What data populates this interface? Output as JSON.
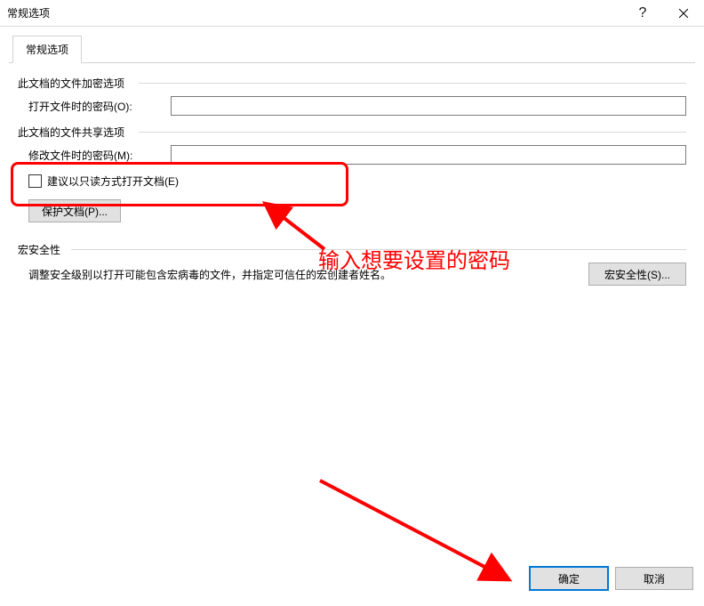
{
  "window": {
    "title": "常规选项"
  },
  "tab": {
    "label": "常规选项"
  },
  "encrypt_group": {
    "title": "此文档的文件加密选项",
    "open_password_label": "打开文件时的密码(O):",
    "open_password_value": ""
  },
  "share_group": {
    "title": "此文档的文件共享选项",
    "modify_password_label": "修改文件时的密码(M):",
    "modify_password_value": "",
    "readonly_label": "建议以只读方式打开文档(E)",
    "protect_button": "保护文档(P)..."
  },
  "macro_group": {
    "title": "宏安全性",
    "description": "调整安全级别以打开可能包含宏病毒的文件，并指定可信任的宏创建者姓名。",
    "macro_button": "宏安全性(S)..."
  },
  "footer": {
    "ok": "确定",
    "cancel": "取消"
  },
  "annotation": {
    "text": "输入想要设置的密码"
  }
}
